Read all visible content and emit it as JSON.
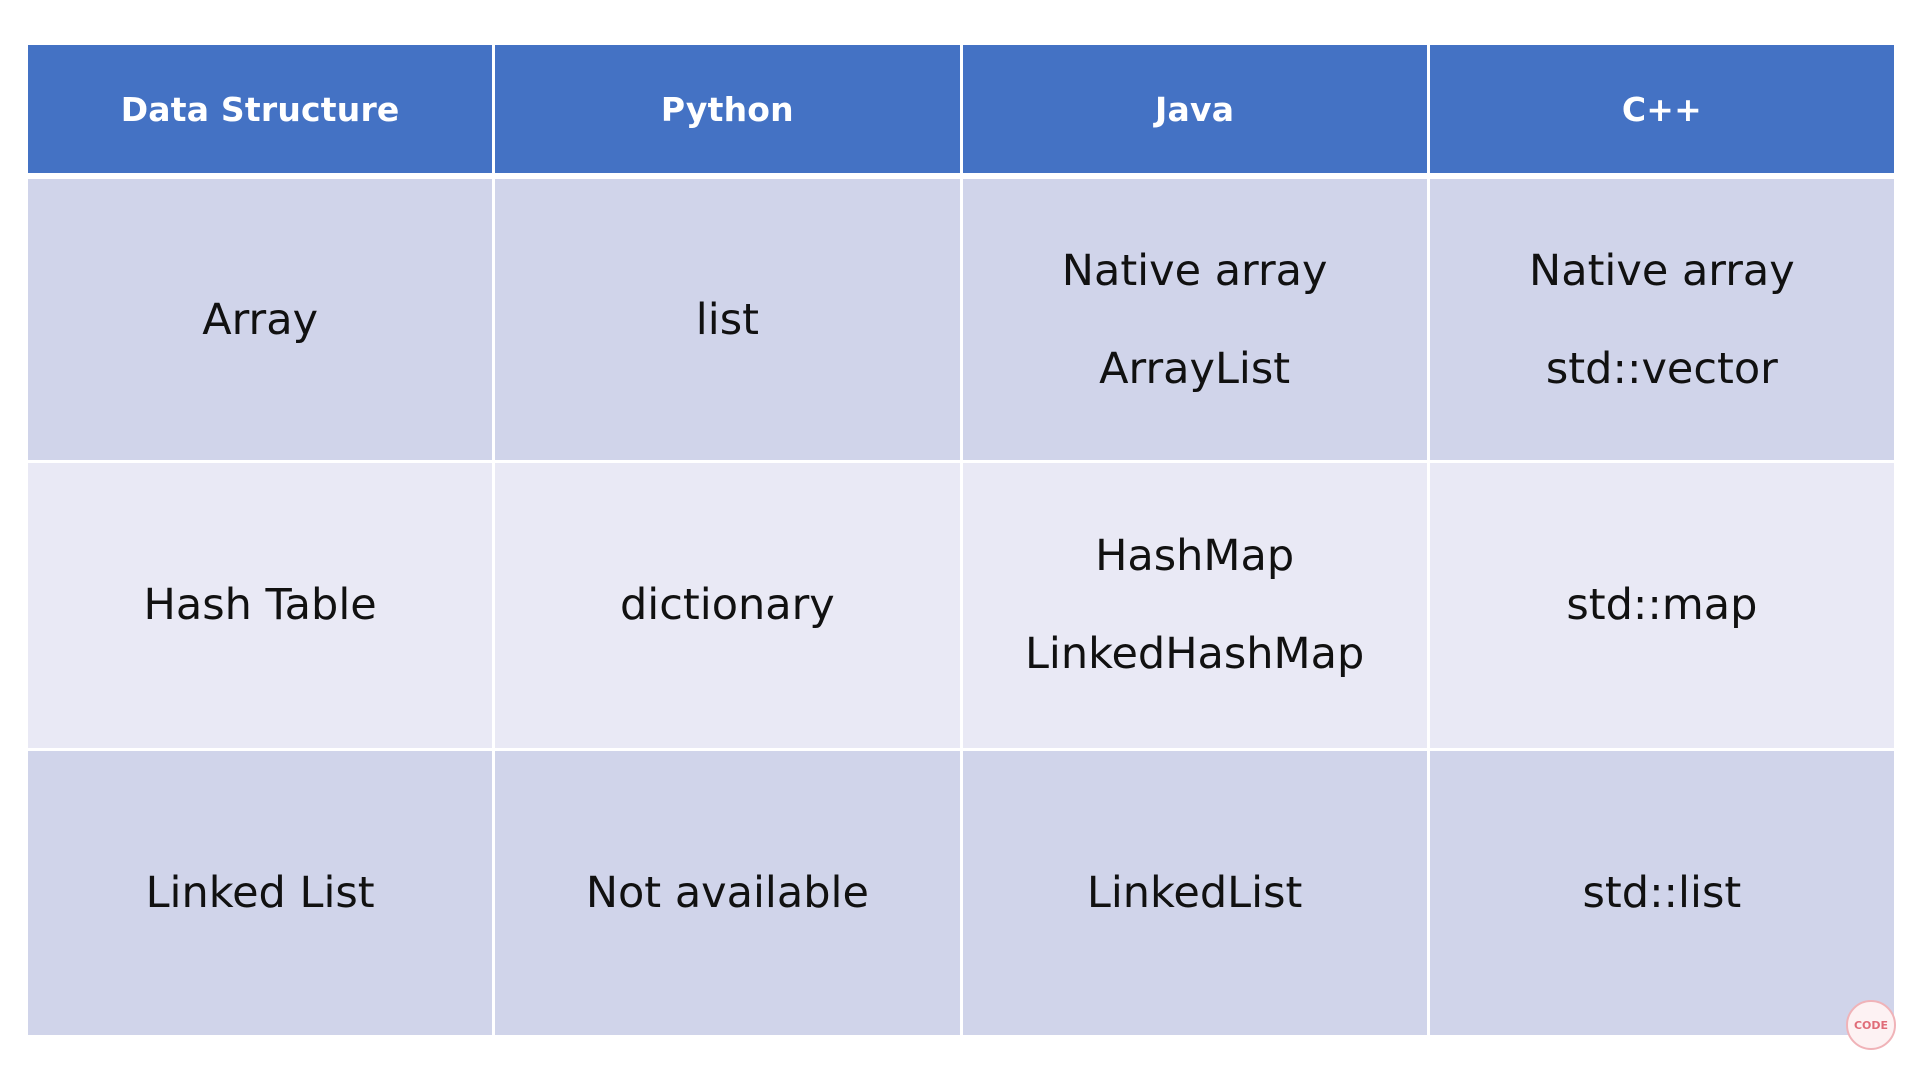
{
  "table": {
    "headers": [
      "Data Structure",
      "Python",
      "Java",
      "C++"
    ],
    "rows": [
      {
        "structure": [
          "Array"
        ],
        "python": [
          "list"
        ],
        "java": [
          "Native array",
          "ArrayList"
        ],
        "cpp": [
          "Native array",
          "std::vector"
        ]
      },
      {
        "structure": [
          "Hash Table"
        ],
        "python": [
          "dictionary"
        ],
        "java": [
          "HashMap",
          "LinkedHashMap"
        ],
        "cpp": [
          "std::map"
        ]
      },
      {
        "structure": [
          "Linked List"
        ],
        "python": [
          "Not available"
        ],
        "java": [
          "LinkedList"
        ],
        "cpp": [
          "std::list"
        ]
      }
    ]
  },
  "colors": {
    "header": "#4472c4",
    "row_odd": "#d0d4ea",
    "row_even": "#e9e9f5"
  },
  "logo": {
    "text": "CODE",
    "icon": "codebasics-logo-icon"
  }
}
